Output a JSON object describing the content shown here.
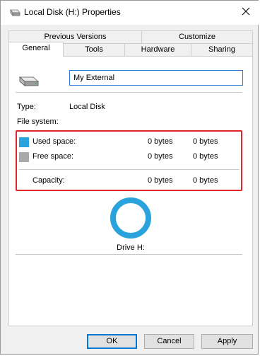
{
  "window": {
    "title": "Local Disk (H:) Properties"
  },
  "tabs": {
    "row1": [
      "Previous Versions",
      "Customize"
    ],
    "row2": [
      "General",
      "Tools",
      "Hardware",
      "Sharing"
    ],
    "active": "General"
  },
  "general": {
    "volume_name": "My External",
    "type_label": "Type:",
    "type_value": "Local Disk",
    "filesystem_label": "File system:",
    "filesystem_value": "",
    "used_label": "Used space:",
    "used_bytes": "0 bytes",
    "used_size": "0 bytes",
    "free_label": "Free space:",
    "free_bytes": "0 bytes",
    "free_size": "0 bytes",
    "capacity_label": "Capacity:",
    "capacity_bytes": "0 bytes",
    "capacity_size": "0 bytes",
    "drive_label": "Drive H:"
  },
  "colors": {
    "used": "#2aa3dc",
    "free": "#a9a9a9",
    "highlight": "#e0262c"
  },
  "buttons": {
    "ok": "OK",
    "cancel": "Cancel",
    "apply": "Apply"
  }
}
